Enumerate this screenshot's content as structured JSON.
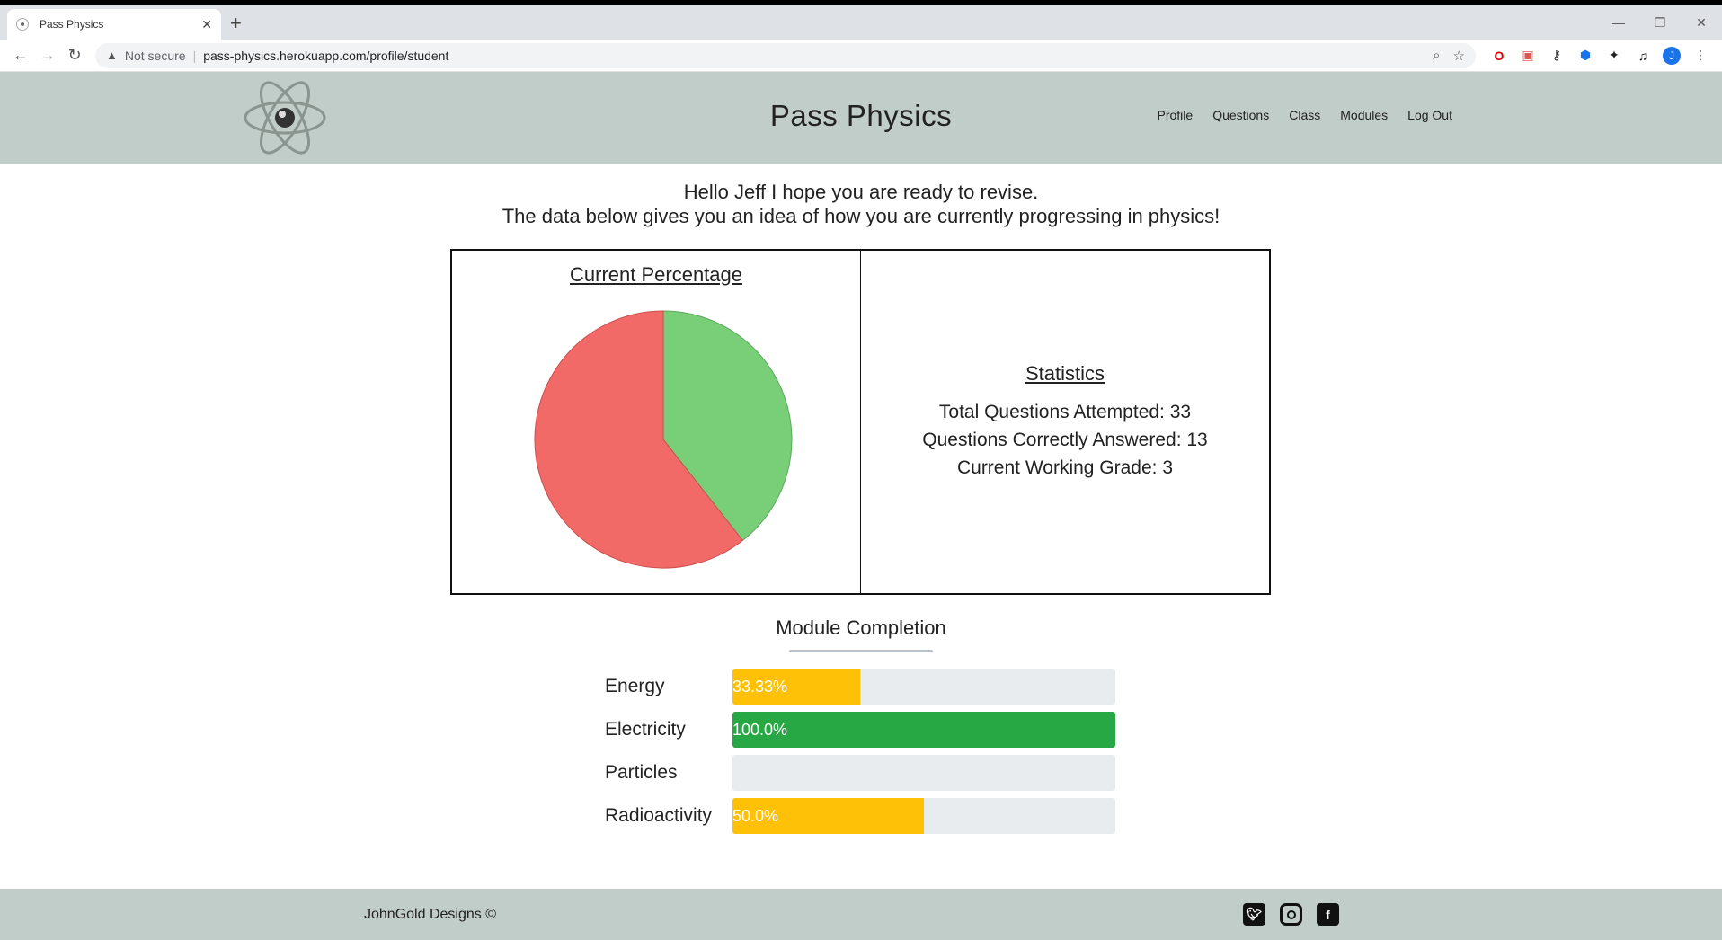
{
  "browser": {
    "tab_title": "Pass Physics",
    "security_label": "Not secure",
    "url": "pass-physics.herokuapp.com/profile/student",
    "profile_initial": "J"
  },
  "header": {
    "title": "Pass Physics",
    "nav": [
      "Profile",
      "Questions",
      "Class",
      "Modules",
      "Log Out"
    ]
  },
  "greeting": {
    "line1": "Hello Jeff I hope you are ready to revise.",
    "line2": "The data below gives you an idea of how you are currently progressing in physics!"
  },
  "chart_section": {
    "title": "Current Percentage"
  },
  "chart_data": {
    "type": "pie",
    "title": "Current Percentage",
    "values": [
      13,
      20
    ],
    "colors": [
      "#79cf78",
      "#f26a68"
    ]
  },
  "statistics": {
    "title": "Statistics",
    "total_label": "Total Questions Attempted: 33",
    "correct_label": "Questions Correctly Answered: 13",
    "grade_label": "Current Working Grade: 3"
  },
  "modules": {
    "title": "Module Completion",
    "items": [
      {
        "name": "Energy",
        "percent": 33.33,
        "label": "33.33%",
        "color": "#ffc107"
      },
      {
        "name": "Electricity",
        "percent": 100.0,
        "label": "100.0%",
        "color": "#28a745"
      },
      {
        "name": "Particles",
        "percent": 0,
        "label": "",
        "color": "#ffc107"
      },
      {
        "name": "Radioactivity",
        "percent": 50.0,
        "label": "50.0%",
        "color": "#ffc107"
      }
    ]
  },
  "footer": {
    "text": "JohnGold Designs ©",
    "social": [
      "twitter-icon",
      "instagram-icon",
      "facebook-icon"
    ]
  },
  "colors": {
    "header_bg": "#c1cdc9",
    "pie_correct": "#79cf78",
    "pie_incorrect": "#f26a68"
  }
}
